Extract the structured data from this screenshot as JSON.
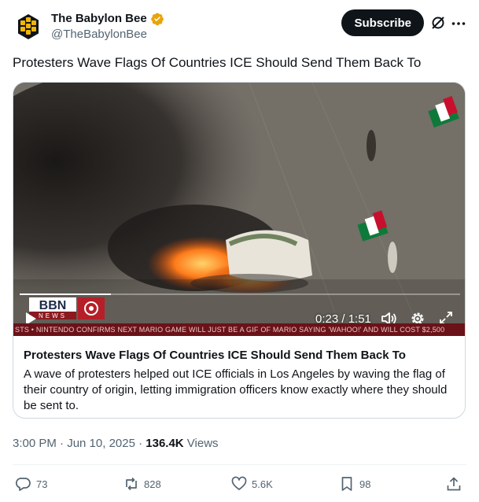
{
  "account": {
    "display_name": "The Babylon Bee",
    "handle": "@TheBabylonBee",
    "avatar_icon": "bee-logo-icon",
    "verified_icon": "verified-badge-icon",
    "verified_color": "#e8a40c"
  },
  "header_actions": {
    "subscribe_label": "Subscribe",
    "grok_icon": "grok-icon",
    "more_icon": "more-icon"
  },
  "tweet": {
    "text": "Protesters Wave Flags Of Countries ICE Should Send Them Back To"
  },
  "video": {
    "logo_text": "BBN",
    "logo_subtext": "NEWS",
    "current_time": "0:23",
    "duration": "1:51",
    "time_display": "0:23 / 1:51",
    "progress_fraction": 0.207,
    "ticker": "STS • NINTENDO CONFIRMS NEXT MARIO GAME WILL JUST BE A GIF OF MARIO SAYING 'WAHOO!' AND WILL COST $2,500"
  },
  "card": {
    "title": "Protesters Wave Flags Of Countries ICE Should Send Them Back To",
    "description": "A wave of protesters helped out ICE officials in Los Angeles by waving the flag of their country of origin, letting immigration officers know exactly where they should be sent to."
  },
  "meta": {
    "timestamp": "3:00 PM · Jun 10, 2025 · ",
    "views_count": "136.4K",
    "views_label": " Views"
  },
  "actions": {
    "replies": "73",
    "reposts": "828",
    "likes": "5.6K",
    "bookmarks": "98"
  },
  "colors": {
    "text_primary": "#0f1419",
    "text_secondary": "#536471",
    "border": "#cfd9de",
    "ticker_bg": "#6b1218"
  }
}
